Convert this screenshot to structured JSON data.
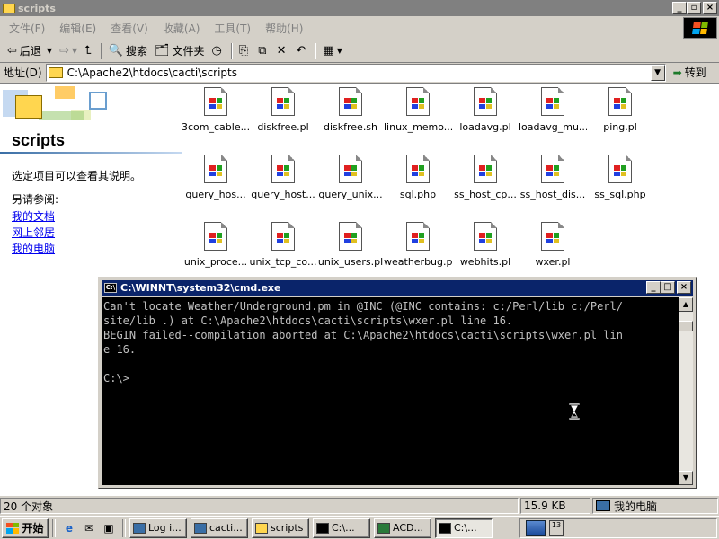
{
  "window": {
    "title": "scripts"
  },
  "menu": [
    "文件(F)",
    "编辑(E)",
    "查看(V)",
    "收藏(A)",
    "工具(T)",
    "帮助(H)"
  ],
  "toolbar": {
    "back": "后退",
    "search": "搜索",
    "folders": "文件夹"
  },
  "address": {
    "label": "地址(D)",
    "value": "C:\\Apache2\\htdocs\\cacti\\scripts",
    "go": "转到"
  },
  "sidebar": {
    "folder_name": "scripts",
    "hint": "选定项目可以查看其说明。",
    "see_also": "另请参阅:",
    "links": [
      "我的文档",
      "网上邻居",
      "我的电脑"
    ]
  },
  "files": [
    "3com_cable...",
    "diskfree.pl",
    "diskfree.sh",
    "linux_memo...",
    "loadavg.pl",
    "loadavg_mu...",
    "ping.pl",
    "query_hos...",
    "query_host...",
    "query_unix...",
    "sql.php",
    "ss_host_cp...",
    "ss_host_dis...",
    "ss_sql.php",
    "unix_proce...",
    "unix_tcp_co...",
    "unix_users.pl",
    "weatherbug.pl",
    "webhits.pl",
    "wxer.pl"
  ],
  "cmd": {
    "title": "C:\\WINNT\\system32\\cmd.exe",
    "output": "Can't locate Weather/Underground.pm in @INC (@INC contains: c:/Perl/lib c:/Perl/\nsite/lib .) at C:\\Apache2\\htdocs\\cacti\\scripts\\wxer.pl line 16.\nBEGIN failed--compilation aborted at C:\\Apache2\\htdocs\\cacti\\scripts\\wxer.pl lin\ne 16.\n\nC:\\>"
  },
  "status": {
    "count": "20 个对象",
    "size": "15.9 KB",
    "zone": "我的电脑"
  },
  "taskbar": {
    "start": "开始",
    "tasks": [
      "Log i...",
      "cacti...",
      "scripts",
      "C:\\...",
      "ACD...",
      "C:\\..."
    ]
  },
  "icons": {
    "title": "folder-icon",
    "file": "perl-script-icon",
    "cmd": "console-icon"
  }
}
